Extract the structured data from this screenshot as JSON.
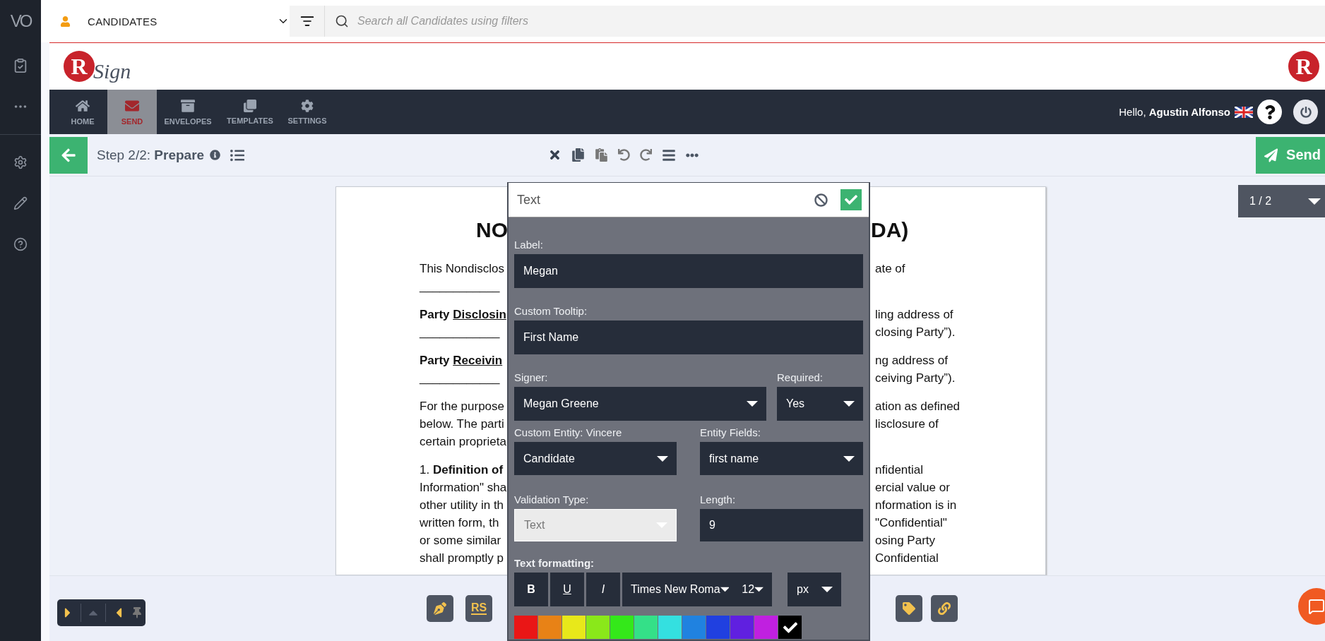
{
  "brand": "VO",
  "app_bar": {
    "module": "CANDIDATES",
    "search": {
      "placeholder": "Search all Candidates using filters"
    }
  },
  "header": {
    "logo_mark": "R",
    "logo_word": "Sign",
    "corner_mark": "R"
  },
  "nav": {
    "items": [
      {
        "label": "HOME",
        "kind": "home",
        "selected": false
      },
      {
        "label": "SEND",
        "kind": "send",
        "selected": true
      },
      {
        "label": "ENVELOPES",
        "kind": "envelopes",
        "selected": false
      },
      {
        "label": "TEMPLATES",
        "kind": "templates",
        "selected": false
      },
      {
        "label": "SETTINGS",
        "kind": "settings",
        "selected": false
      }
    ],
    "greeting": "Hello,",
    "user": "Agustin Alfonso"
  },
  "step_bar": {
    "step": "Step 2/2:",
    "title": "Prepare",
    "send": "Send"
  },
  "pager": {
    "label": "1 / 2"
  },
  "document": {
    "paragraphs": [
      {
        "kind": "title",
        "lines": [
          {
            "left": "NO",
            "right": "DA)"
          }
        ]
      },
      {
        "kind": "text",
        "lines": [
          {
            "left": "This Nondisclos",
            "right": "ate of"
          },
          {
            "left": "____________"
          }
        ]
      },
      {
        "kind": "text",
        "lines": [
          {
            "left": "**Party**",
            "term": "Disclosin",
            "right": "ling address of"
          },
          {
            "left": "____________",
            "right": "closing Party”)."
          }
        ]
      },
      {
        "kind": "text",
        "lines": [
          {
            "left": "**Party**",
            "term": "Receivin",
            "right": "ng address of"
          },
          {
            "left": "____________",
            "right": "ceiving Party”)."
          }
        ]
      },
      {
        "kind": "text",
        "lines": [
          {
            "left": "For the purpose",
            "right": "ation as defined"
          },
          {
            "left": "below. The parti",
            "right": "lisclosure of"
          },
          {
            "left": "certain proprieta"
          }
        ]
      },
      {
        "kind": "text",
        "lines": [
          {
            "left": "1. **Definition of**",
            "right": "nfidential"
          },
          {
            "left": "Information\" sha",
            "right": "ercial value or"
          },
          {
            "left": "other utility in th",
            "right": "nformation is in"
          },
          {
            "left": "written form, th",
            "right": "\"Confidential\""
          },
          {
            "left": "or some similar",
            "right": "osing Party"
          },
          {
            "left": "shall promptly p",
            "right": "Confidential"
          }
        ]
      }
    ]
  },
  "field_editor": {
    "title": "Text",
    "label": {
      "caption": "Label:",
      "value": "Megan"
    },
    "tooltip": {
      "caption": "Custom Tooltip:",
      "value": "First Name"
    },
    "signer": {
      "caption": "Signer:",
      "value": "Megan Greene"
    },
    "required": {
      "caption": "Required:",
      "value": "Yes"
    },
    "entity": {
      "caption": "Custom Entity: Vincere",
      "value": "Candidate"
    },
    "entity_fields": {
      "caption": "Entity Fields:",
      "value": "first name"
    },
    "validation": {
      "caption": "Validation Type:",
      "value": "Text",
      "disabled": true
    },
    "length": {
      "caption": "Length:",
      "value": "9"
    },
    "formatting": {
      "caption": "Text formatting:",
      "styles": [
        {
          "kind": "bold",
          "label": "B"
        },
        {
          "kind": "underline",
          "label": "U"
        },
        {
          "kind": "italic",
          "label": "I"
        }
      ],
      "font": "Times New Roma",
      "size": "12",
      "unit": "px",
      "colors": [
        {
          "color": "#ea1616",
          "selected": false
        },
        {
          "color": "#e88216",
          "selected": false
        },
        {
          "color": "#e8e81a",
          "selected": false
        },
        {
          "color": "#8ae81a",
          "selected": false
        },
        {
          "color": "#34e81a",
          "selected": false
        },
        {
          "color": "#34e088",
          "selected": false
        },
        {
          "color": "#34e0e0",
          "selected": false
        },
        {
          "color": "#2082e0",
          "selected": false
        },
        {
          "color": "#2040e0",
          "selected": false
        },
        {
          "color": "#6020e0",
          "selected": false
        },
        {
          "color": "#c020e0",
          "selected": false
        },
        {
          "color": "#000000",
          "selected": true
        }
      ]
    }
  },
  "tools": [
    {
      "kind": "pen"
    },
    {
      "kind": "initials",
      "label": "RS"
    },
    {
      "kind": "tag"
    },
    {
      "kind": "link"
    }
  ]
}
